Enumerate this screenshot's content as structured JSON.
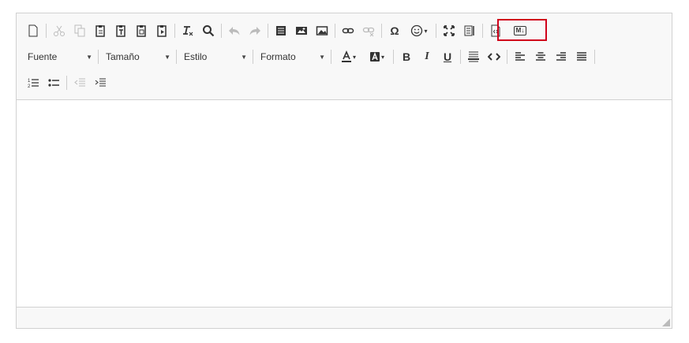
{
  "toolbar": {
    "font_label": "Fuente",
    "size_label": "Tamaño",
    "style_label": "Estilo",
    "format_label": "Formato",
    "bold_label": "B",
    "italic_label": "I",
    "underline_label": "U",
    "omega_label": "Ω",
    "md_label": "M↓"
  },
  "colors": {
    "highlight": "#d0021b",
    "border": "#d1d1d1",
    "toolbar_bg": "#f8f8f8"
  }
}
